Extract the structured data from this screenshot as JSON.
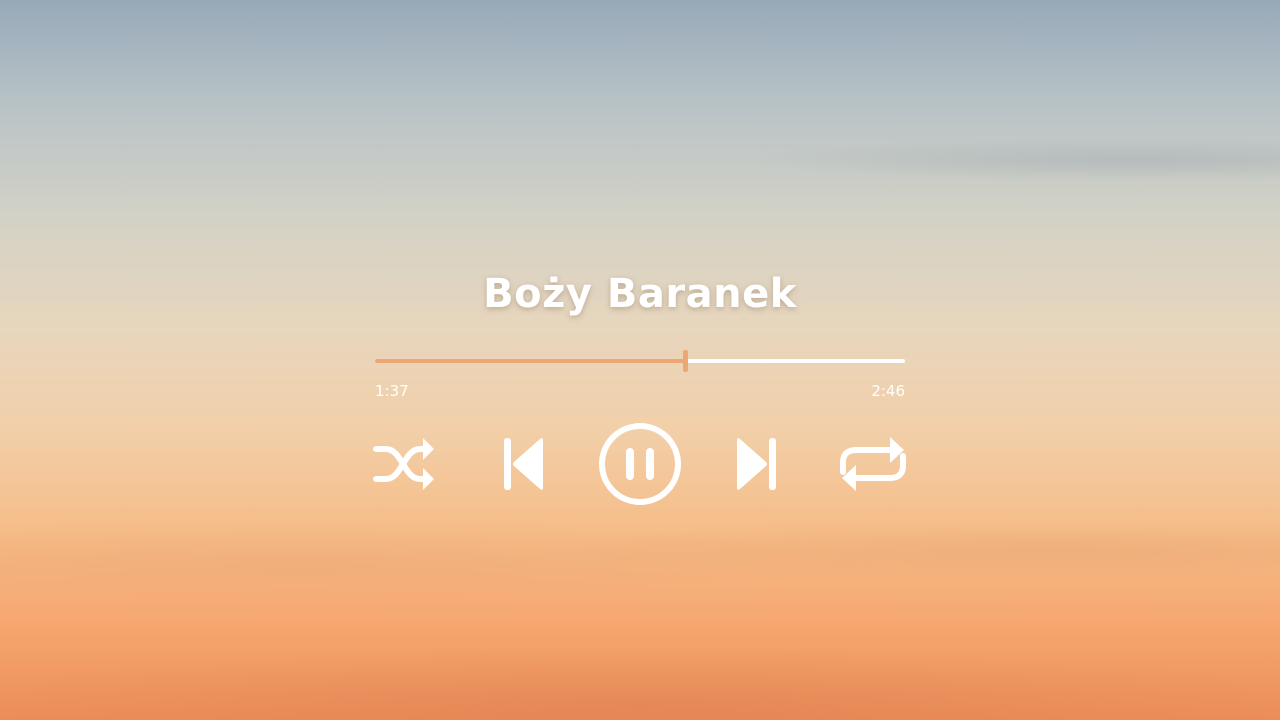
{
  "track": {
    "title": "Boży Baranek"
  },
  "playback": {
    "elapsed": "1:37",
    "duration": "2:46",
    "progress_fraction": 0.584,
    "state": "playing"
  },
  "controls": {
    "shuffle_icon": "shuffle-icon",
    "previous_icon": "skip-previous-icon",
    "pause_icon": "pause-icon",
    "next_icon": "skip-next-icon",
    "repeat_icon": "repeat-icon"
  },
  "colors": {
    "foreground": "#ffffff",
    "accent": "#eda775"
  }
}
